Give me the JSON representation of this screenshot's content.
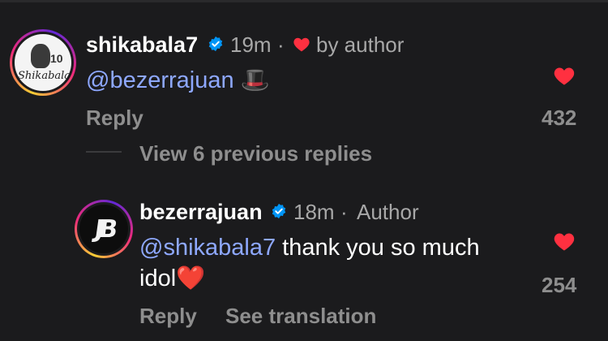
{
  "comments": [
    {
      "username": "shikabala7",
      "time": "19m",
      "separator": "·",
      "liked_by": "by author",
      "mention": "@bezerrajuan",
      "text": "",
      "emoji": "🎩",
      "reply_label": "Reply",
      "like_count": "432",
      "avatar_caption": "Shikabala",
      "avatar_number": "10"
    },
    {
      "username": "bezerrajuan",
      "time": "18m",
      "separator": "·",
      "role": "Author",
      "mention": "@shikabala7",
      "text_line1": " thank you so much",
      "text_line2": "idol",
      "emoji": "❤️",
      "reply_label": "Reply",
      "translate_label": "See translation",
      "like_count": "254",
      "avatar_logo": "JB"
    }
  ],
  "view_replies_label": "View 6 previous replies",
  "colors": {
    "background": "#1b1b1d",
    "mention": "#8ea8ff",
    "like": "#ff3040",
    "verified": "#0095f6",
    "muted": "#8e8e8e"
  },
  "icons": [
    "verified-badge-icon",
    "heart-icon",
    "heart-outline-icon"
  ]
}
